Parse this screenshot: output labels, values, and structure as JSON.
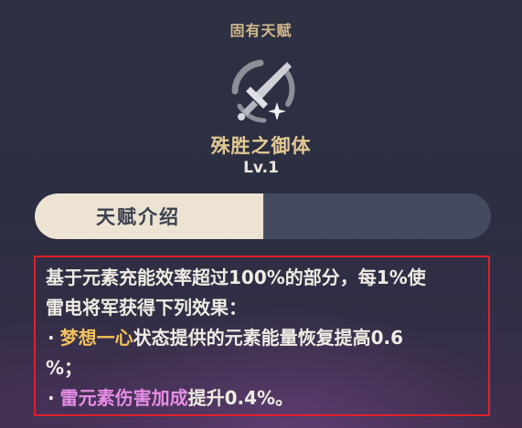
{
  "header": {
    "label": "固有天赋"
  },
  "talent": {
    "icon": "sword-emblem-icon",
    "name": "殊胜之御体",
    "level": "Lv.1"
  },
  "tabs": [
    {
      "label": "天赋介绍",
      "active": true
    },
    {
      "label": "",
      "active": false
    }
  ],
  "description": {
    "line1": "基于元素充能效率超过100%的部分，每1%使",
    "line2": "雷电将军获得下列效果：",
    "bullet": "·",
    "line3_highlight": "梦想一心",
    "line3_rest": "状态提供的元素能量恢复提高0.6",
    "line4": "%；",
    "line5_highlight": "雷元素伤害加成",
    "line5_rest": "提升0.4%。"
  },
  "colors": {
    "header_gold": "#d2b98c",
    "name_gold": "#e3c894",
    "highlight_gold": "#f2c25a",
    "highlight_pink": "#e68de6",
    "tab_active_bg": "#ece3d2",
    "tab_inactive_bg": "#454b5f",
    "annotation_red": "#e21f2b"
  }
}
